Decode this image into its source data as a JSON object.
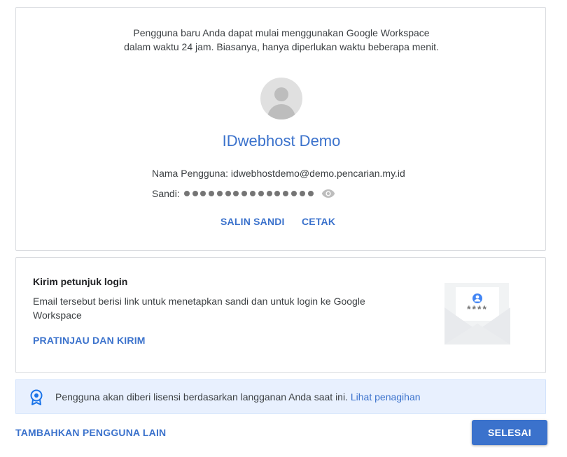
{
  "user_card": {
    "intro": "Pengguna baru Anda dapat mulai menggunakan Google Workspace dalam waktu 24 jam. Biasanya, hanya diperlukan waktu beberapa menit.",
    "name": "IDwebhost Demo",
    "username_label": "Nama Pengguna:",
    "username_value": "idwebhostdemo@demo.pencarian.my.id",
    "password_label": "Sandi:",
    "password_mask_length": 16,
    "copy_label": "SALIN SANDI",
    "print_label": "CETAK",
    "avatar_icon": "person-icon",
    "eye_icon": "eye-icon"
  },
  "login_card": {
    "title": "Kirim petunjuk login",
    "description": "Email tersebut berisi link untuk menetapkan sandi dan untuk login ke Google Workspace",
    "preview_label": "PRATINJAU DAN KIRIM",
    "illustration_icon": "envelope-icon",
    "illustration_mask": "****"
  },
  "banner": {
    "message": "Pengguna akan diberi lisensi berdasarkan langganan Anda saat ini.",
    "link": "Lihat penagihan",
    "icon": "license-badge-icon"
  },
  "footer": {
    "add_user_label": "TAMBAHKAN PENGGUNA LAIN",
    "done_label": "SELESAI"
  },
  "colors": {
    "accent": "#3b72cc",
    "banner_bg": "#e8f0fe",
    "border": "#dadce0"
  }
}
